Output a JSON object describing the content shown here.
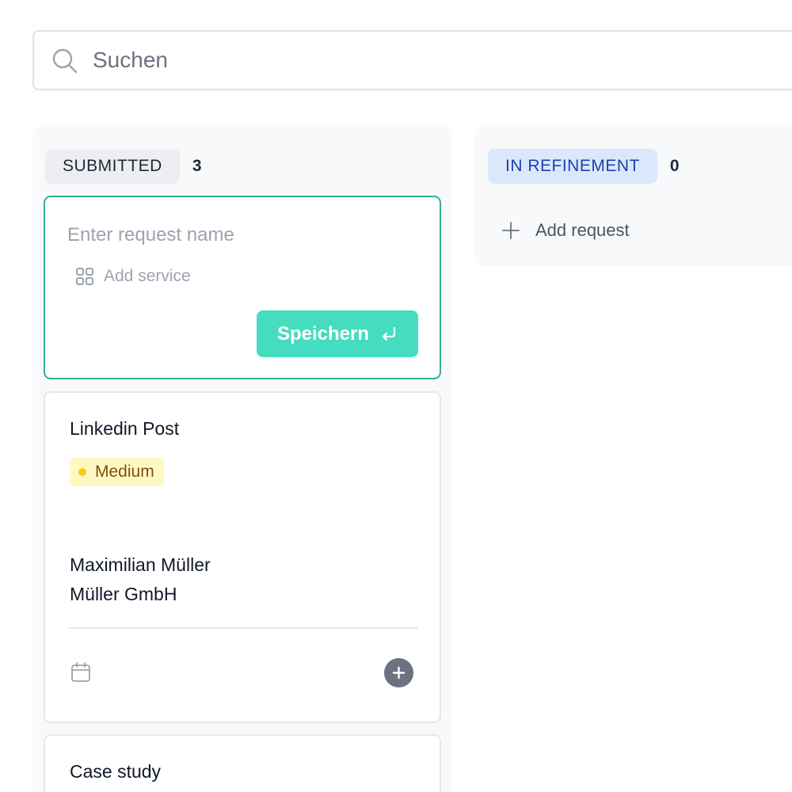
{
  "search": {
    "placeholder": "Suchen",
    "icon": "search-icon"
  },
  "columns": [
    {
      "status": "SUBMITTED",
      "count": "3",
      "pill_color": "#eceef1",
      "new_request": {
        "name_placeholder": "Enter request name",
        "add_service_label": "Add service",
        "save_label": "Speichern",
        "accent": "#2fb391",
        "button_color": "#45dcbf"
      },
      "cards": [
        {
          "title": "Linkedin Post",
          "priority": "Medium",
          "priority_color": "#facc15",
          "contact_name": "Maximilian Müller",
          "company": "Müller GmbH"
        },
        {
          "title": "Case study"
        }
      ]
    },
    {
      "status": "IN REFINEMENT",
      "count": "0",
      "pill_color": "#dbe8fb",
      "add_request_label": "Add request"
    }
  ]
}
